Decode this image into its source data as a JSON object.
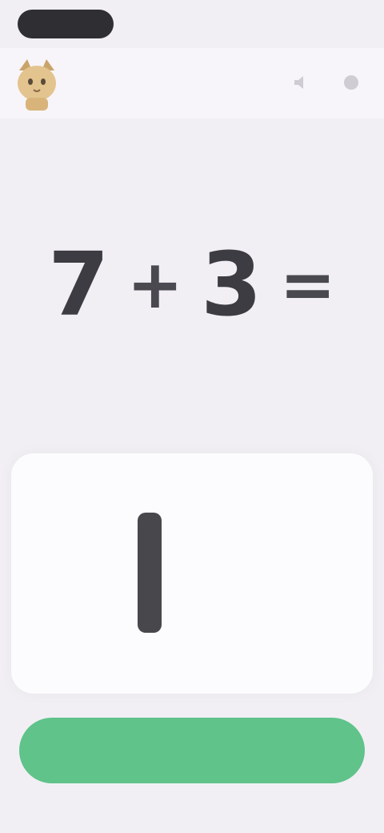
{
  "header": {
    "title": "",
    "app_icon": "cat-mascot-icon",
    "actions": [
      {
        "icon": "volume-icon"
      },
      {
        "icon": "menu-icon"
      }
    ]
  },
  "equation": {
    "left": "7",
    "operator": "+",
    "right": "3",
    "equals": "="
  },
  "answer": {
    "value": "1"
  },
  "check_button": {
    "label": ""
  },
  "colors": {
    "background": "#f1eff4",
    "button": "#5fc38a",
    "text": "#3d3c42"
  }
}
